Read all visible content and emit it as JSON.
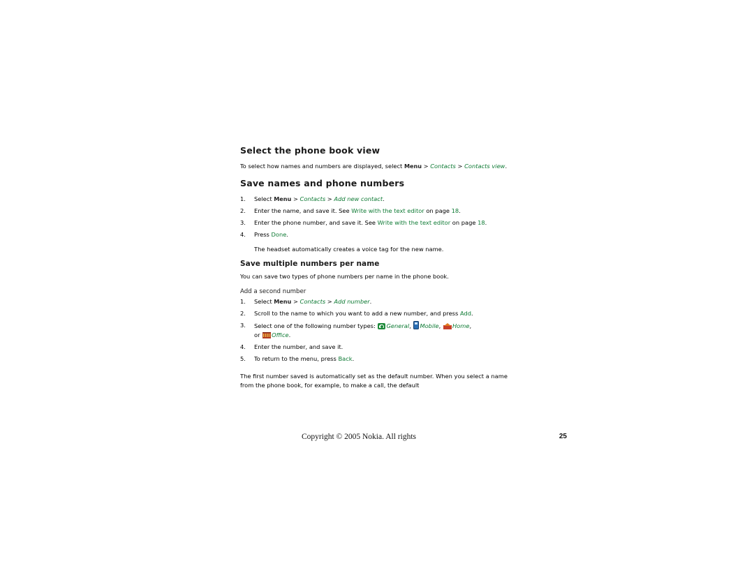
{
  "document": {
    "section1": {
      "heading": "Select the phone book view",
      "para_1a": "To select how names and numbers are displayed, select ",
      "menu": "Menu",
      "sep": " > ",
      "contacts": "Contacts",
      "para_1b": "Contacts view",
      "period": "."
    },
    "section2": {
      "heading": "Save names and phone numbers",
      "steps": [
        {
          "lead": "Select ",
          "menu": "Menu",
          "sep1": " > ",
          "contacts": "Contacts",
          "sep2": " > ",
          "link": "Add new contact",
          "tail": "."
        },
        {
          "lead": "Enter the name, and save it. See ",
          "link": "Write with the text editor",
          "mid": " on page ",
          "page": "18",
          "tail": "."
        },
        {
          "lead": "Enter the phone number, and save it. See ",
          "link": "Write with the text editor",
          "mid": " on page ",
          "page": "18",
          "tail": "."
        },
        {
          "lead": "Press ",
          "bold": "Done",
          "tail": "."
        }
      ],
      "note": "The headset automatically creates a voice tag for the new name."
    },
    "section3": {
      "heading": "Save multiple numbers per name",
      "intro": "You can save two types of phone numbers per name in the phone book.",
      "minor_heading": "Add a second number",
      "steps": [
        {
          "lead": "Select ",
          "menu": "Menu",
          "sep1": " > ",
          "contacts": "Contacts",
          "sep2": " > ",
          "link": "Add number",
          "tail": "."
        },
        {
          "lead": "Scroll to the name to which you want to add a new number, and press ",
          "bold": "Add",
          "tail": "."
        },
        {
          "lead": "Select one of the following number types: ",
          "type_general": "General",
          "comma1": ", ",
          "type_mobile": "Mobile",
          "comma2": ", ",
          "type_home": "Home",
          "comma3": ",",
          "or": "or ",
          "type_office": "Office",
          "tail": "."
        },
        {
          "lead": "Enter the number, and save it."
        },
        {
          "lead": "To return to the menu, press ",
          "bold": "Back",
          "tail": "."
        }
      ],
      "closing": "The first number saved is automatically set as the default number. When you select a name from the phone book, for example, to make a call, the default"
    }
  },
  "footer": {
    "copyright": "Copyright © 2005 Nokia. All rights",
    "page_number": "25"
  },
  "icons": {
    "general": "phone-general-icon",
    "mobile": "phone-mobile-icon",
    "home": "phone-home-icon",
    "office": "phone-office-icon"
  },
  "colors": {
    "link_green": "#0e7a34",
    "text": "#000000"
  }
}
